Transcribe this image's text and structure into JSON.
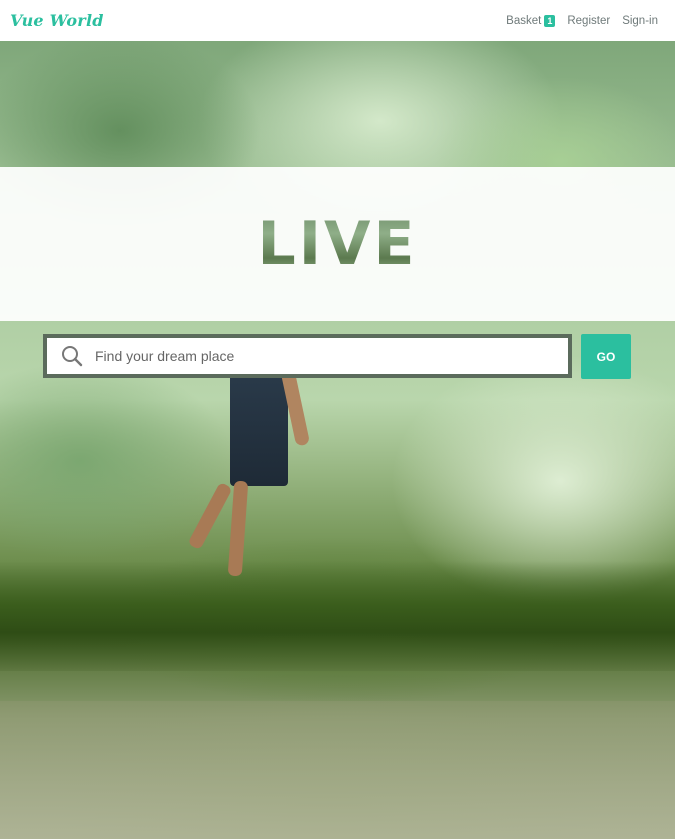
{
  "header": {
    "logo": "Vue World",
    "nav": {
      "basket_label": "Basket",
      "basket_count": "1",
      "register_label": "Register",
      "signin_label": "Sign-in"
    }
  },
  "hero": {
    "title": "LIVE"
  },
  "search": {
    "placeholder": "Find your dream place",
    "value": "",
    "button_label": "GO"
  },
  "colors": {
    "accent": "#2bbf9f",
    "search_border": "#5b6b5c"
  }
}
